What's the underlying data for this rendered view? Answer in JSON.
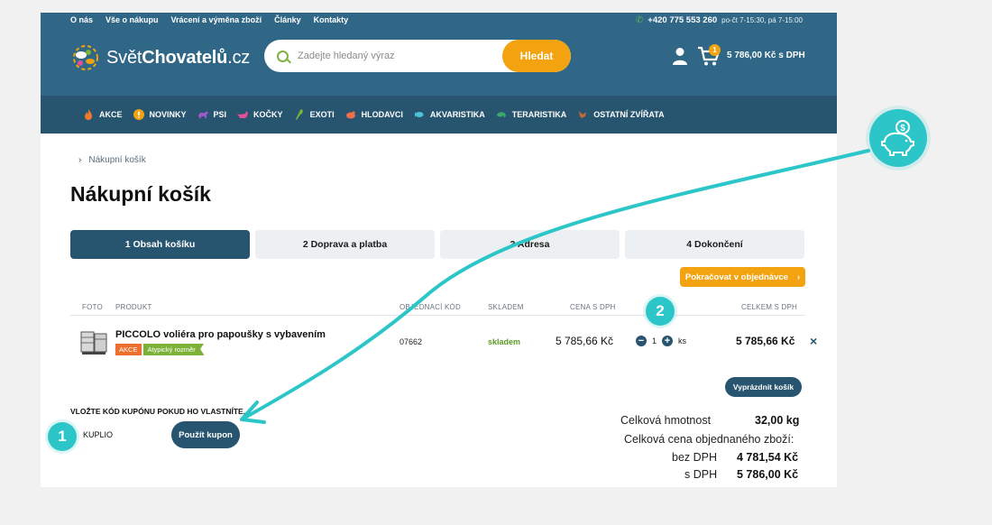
{
  "top_links": [
    "O nás",
    "Vše o nákupu",
    "Vrácení a výměna zboží",
    "Články",
    "Kontakty"
  ],
  "contact": {
    "phone": "+420 775 553 260",
    "hours": "po-čt 7-15:30, pá 7-15:00"
  },
  "logo": {
    "part1": "Svět",
    "part2": "Chovatelů",
    "part3": ".cz"
  },
  "search": {
    "placeholder": "Zadejte hledaný výraz",
    "button": "Hledat"
  },
  "cart": {
    "count": "1",
    "total": "5 786,00 Kč s DPH"
  },
  "nav": [
    {
      "label": "AKCE",
      "icon": "flame-icon",
      "color": "#f0792e"
    },
    {
      "label": "NOVINKY",
      "icon": "exclamation-icon",
      "color": "#f3a30f"
    },
    {
      "label": "PSI",
      "icon": "dog-icon",
      "color": "#9b59c9"
    },
    {
      "label": "KOČKY",
      "icon": "cat-icon",
      "color": "#e0509a"
    },
    {
      "label": "EXOTI",
      "icon": "parrot-icon",
      "color": "#7cb238"
    },
    {
      "label": "HLODAVCI",
      "icon": "rodent-icon",
      "color": "#ee6f4d"
    },
    {
      "label": "AKVARISTIKA",
      "icon": "fish-icon",
      "color": "#4cc3d6"
    },
    {
      "label": "TERARISTIKA",
      "icon": "chameleon-icon",
      "color": "#3aa86b"
    },
    {
      "label": "OSTATNÍ ZVÍŘATA",
      "icon": "bird-icon",
      "color": "#c06a3b"
    }
  ],
  "breadcrumb": "Nákupní košík",
  "title": "Nákupní košík",
  "steps": [
    "1 Obsah košíku",
    "2 Doprava a platba",
    "3 Adresa",
    "4 Dokončení"
  ],
  "continue_button": "Pokračovat v objednávce",
  "table_headers": {
    "photo": "FOTO",
    "product": "PRODUKT",
    "code": "OBJEDNACÍ KÓD",
    "stock": "SKLADEM",
    "price": "CENA S DPH",
    "total": "CELKEM S DPH"
  },
  "item": {
    "name": "PICCOLO voliéra pro papoušky s vybavením",
    "badges": [
      "AKCE",
      "Atypický rozměr"
    ],
    "code": "07662",
    "stock": "skladem",
    "price": "5 785,66 Kč",
    "qty": "1",
    "unit": "ks",
    "total": "5 785,66 Kč",
    "remove": "×"
  },
  "empty_cart_button": "Vyprázdnit košík",
  "coupon": {
    "label": "VLOŽTE KÓD KUPÓNU POKUD HO VLASTNÍTE.",
    "value": "KUPLIO",
    "button": "Použít kupon"
  },
  "summary": {
    "weight_label": "Celková hmotnost",
    "weight": "32,00 kg",
    "price_label": "Celková cena objednaného zboží:",
    "excl_label": "bez DPH",
    "excl": "4 781,54 Kč",
    "incl_label": "s DPH",
    "incl": "5 786,00 Kč"
  },
  "callouts": {
    "one": "1",
    "two": "2"
  },
  "colors": {
    "header": "#306786",
    "nav": "#27546e",
    "accent": "#f3a30f",
    "teal": "#2dc6c8"
  }
}
